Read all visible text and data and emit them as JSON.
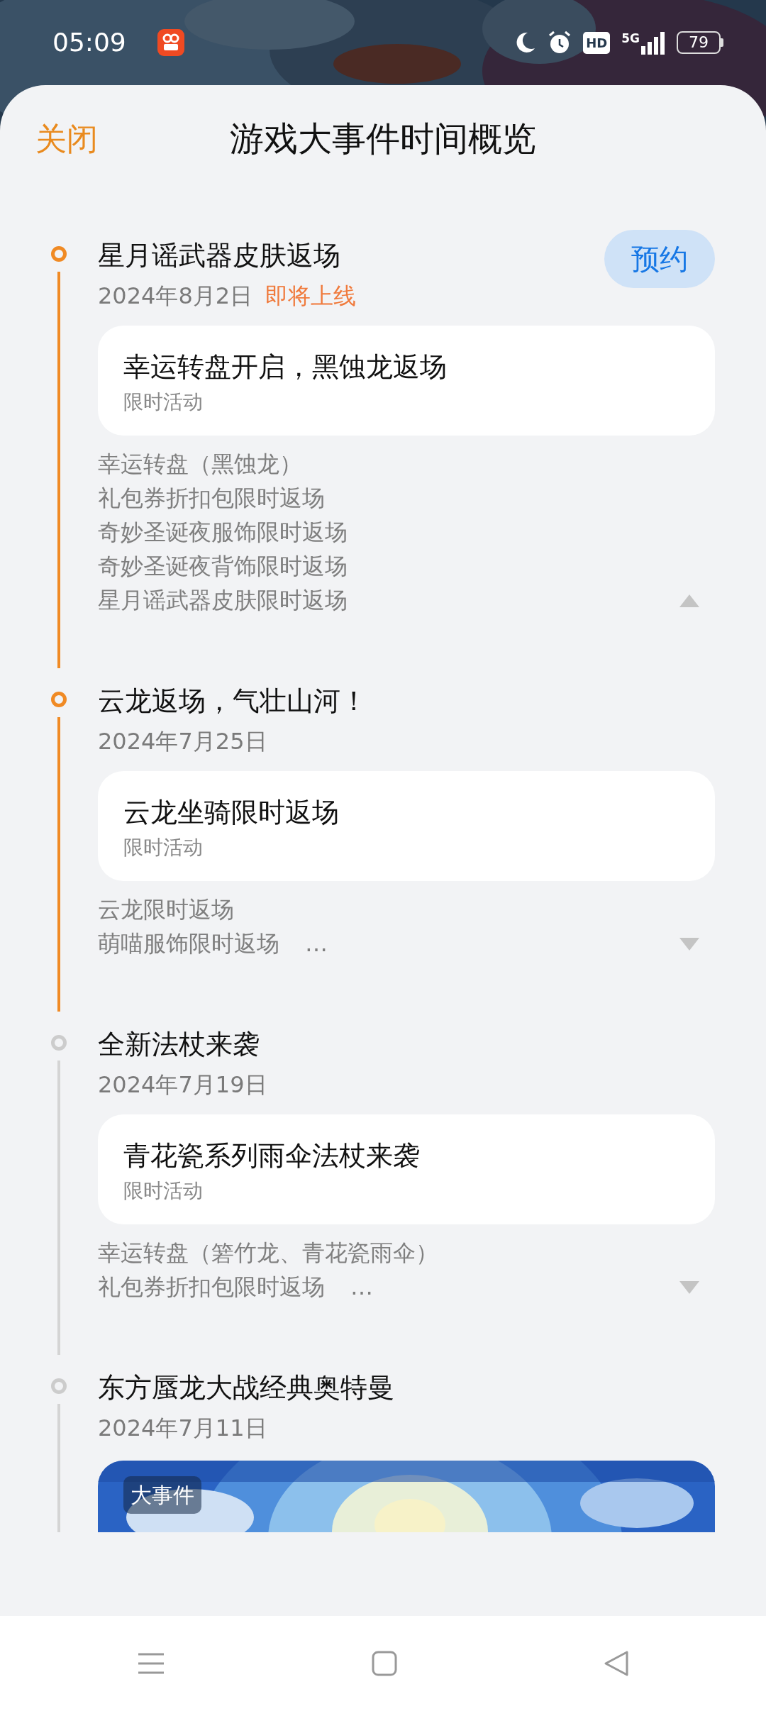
{
  "status_bar": {
    "time": "05:09",
    "hd": "HD",
    "network": "5G",
    "battery": "79"
  },
  "header": {
    "close": "关闭",
    "title": "游戏大事件时间概览"
  },
  "events": [
    {
      "title": "星月谣武器皮肤返场",
      "date": "2024年8月2日",
      "status": "即将上线",
      "button": "预约",
      "active": true,
      "expanded": true,
      "card": {
        "kind": "card",
        "title": "幸运转盘开启，黑蚀龙返场",
        "subtitle": "限时活动"
      },
      "details": [
        "幸运转盘（黑蚀龙）",
        "礼包券折扣包限时返场",
        "奇妙圣诞夜服饰限时返场",
        "奇妙圣诞夜背饰限时返场",
        "星月谣武器皮肤限时返场"
      ]
    },
    {
      "title": "云龙返场，气壮山河！",
      "date": "2024年7月25日",
      "active": true,
      "expanded": false,
      "card": {
        "kind": "card",
        "title": "云龙坐骑限时返场",
        "subtitle": "限时活动"
      },
      "details": [
        "云龙限时返场",
        "萌喵服饰限时返场"
      ],
      "more": "…"
    },
    {
      "title": "全新法杖来袭",
      "date": "2024年7月19日",
      "active": false,
      "expanded": false,
      "card": {
        "kind": "card",
        "title": "青花瓷系列雨伞法杖来袭",
        "subtitle": "限时活动"
      },
      "details": [
        "幸运转盘（箬竹龙、青花瓷雨伞）",
        "礼包券折扣包限时返场"
      ],
      "more": "…"
    },
    {
      "title": "东方蜃龙大战经典奥特曼",
      "date": "2024年7月11日",
      "active": false,
      "card": {
        "kind": "banner",
        "badge": "大事件"
      }
    }
  ]
}
